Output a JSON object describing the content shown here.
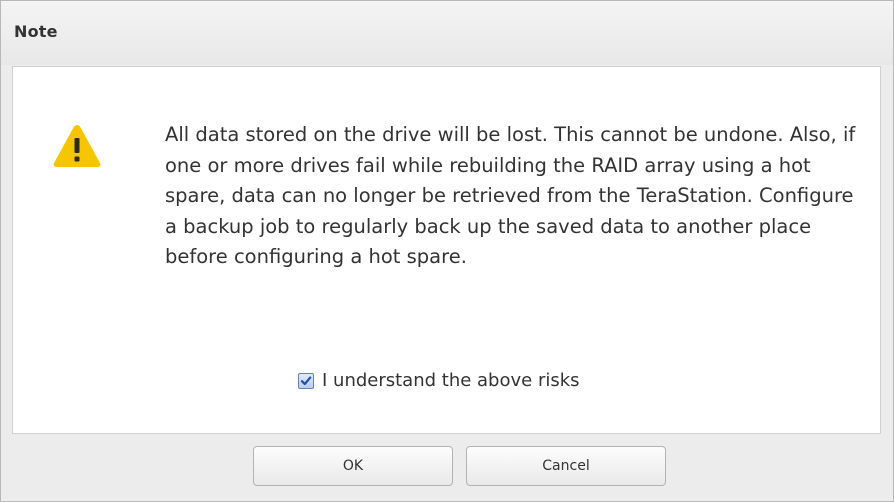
{
  "dialog": {
    "title": "Note",
    "message": "All data stored on the drive will be lost. This cannot be undone. Also, if one or more drives fail while rebuilding the RAID array using a hot spare, data can no longer be retrieved from the TeraStation. Configure a backup job to regularly back up the saved data to another place before configuring a hot spare.",
    "icon": "warning-icon",
    "checkbox": {
      "label": "I understand the above risks",
      "checked": true
    },
    "buttons": {
      "ok_label": "OK",
      "cancel_label": "Cancel"
    }
  },
  "colors": {
    "warning": "#f7c500",
    "checkbox_accent": "#3a6fc4"
  }
}
